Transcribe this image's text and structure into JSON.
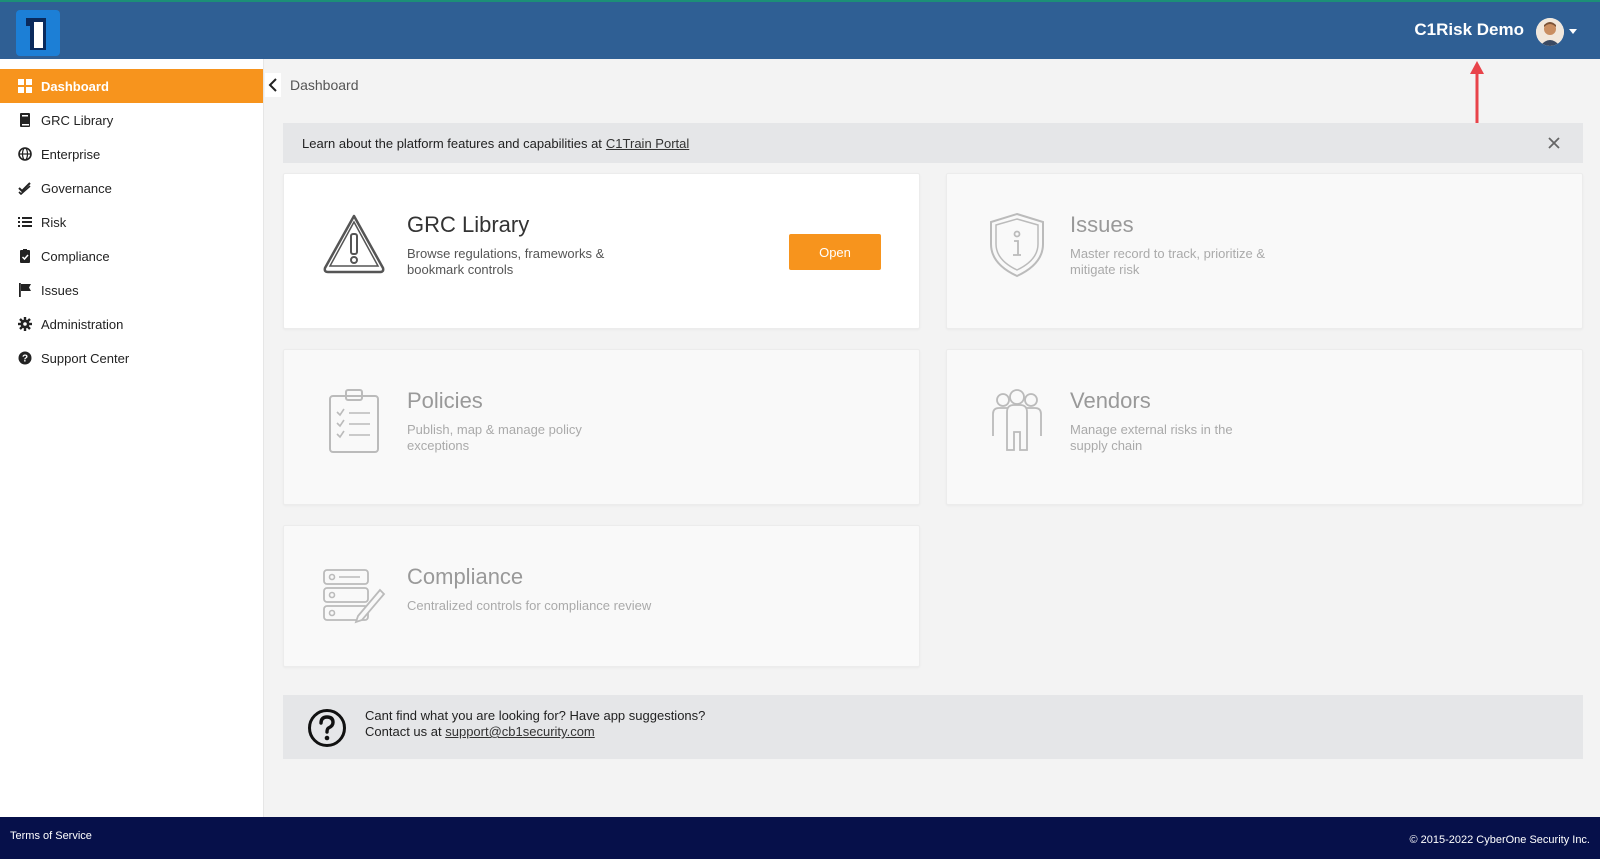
{
  "header": {
    "user_name": "C1Risk Demo"
  },
  "sidebar": {
    "items": [
      {
        "label": "Dashboard",
        "icon": "dashboard-icon",
        "active": true
      },
      {
        "label": "GRC Library",
        "icon": "book-icon"
      },
      {
        "label": "Enterprise",
        "icon": "globe-icon"
      },
      {
        "label": "Governance",
        "icon": "check-double-icon"
      },
      {
        "label": "Risk",
        "icon": "list-icon"
      },
      {
        "label": "Compliance",
        "icon": "clipboard-check-icon"
      },
      {
        "label": "Issues",
        "icon": "flag-icon"
      },
      {
        "label": "Administration",
        "icon": "gear-icon"
      },
      {
        "label": "Support Center",
        "icon": "question-circle-icon"
      }
    ]
  },
  "breadcrumb": "Dashboard",
  "banner": {
    "text": "Learn about the platform features and capabilities at",
    "link": "C1Train Portal"
  },
  "cards": {
    "grc": {
      "title": "GRC Library",
      "desc": "Browse regulations, frameworks & bookmark controls",
      "button": "Open"
    },
    "issues": {
      "title": "Issues",
      "desc": "Master record to track, prioritize & mitigate risk"
    },
    "policies": {
      "title": "Policies",
      "desc": "Publish, map & manage policy exceptions"
    },
    "vendors": {
      "title": "Vendors",
      "desc": "Manage external risks in the supply chain"
    },
    "compliance": {
      "title": "Compliance",
      "desc": "Centralized controls for compliance review"
    }
  },
  "help": {
    "line1": "Cant find what you are looking for? Have app suggestions?",
    "line2": "Contact us at",
    "email": "support@cb1security.com"
  },
  "footer": {
    "tos": "Terms of Service",
    "copyright": "© 2015-2022 CyberOne Security Inc."
  },
  "colors": {
    "topbar": "#2f5f94",
    "accent": "#f7941d",
    "footer": "#06104a",
    "annotation_arrow": "#e8434a"
  }
}
